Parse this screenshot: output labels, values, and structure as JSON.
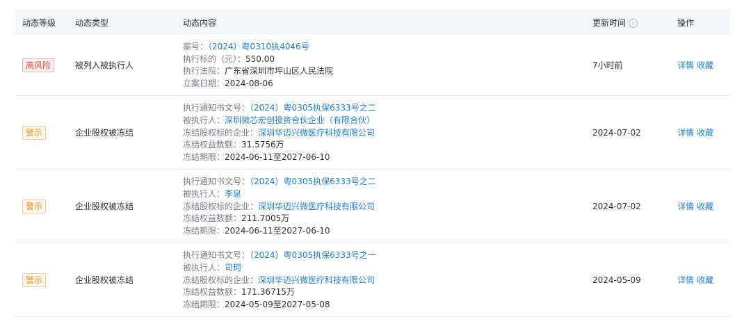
{
  "table": {
    "headers": {
      "level": "动态等级",
      "type": "动态类型",
      "content": "动态内容",
      "time": "更新时间",
      "ops": "操作"
    },
    "rows": [
      {
        "level": "高风险",
        "level_kind": "high",
        "type": "被列入被执行人",
        "fields": [
          {
            "label": "案号：",
            "value": "（2024）粤0310执4046号",
            "is_link": true
          },
          {
            "label": "执行标的（元）：",
            "value": "550.00",
            "is_link": false
          },
          {
            "label": "执行法院：",
            "value": "广东省深圳市坪山区人民法院",
            "is_link": false
          },
          {
            "label": "立案日期：",
            "value": "2024-08-06",
            "is_link": false
          }
        ],
        "time": "7小时前",
        "op_detail": "详情",
        "op_collect": "收藏"
      },
      {
        "level": "警示",
        "level_kind": "warn",
        "type": "企业股权被冻结",
        "fields": [
          {
            "label": "执行通知书文号：",
            "value": "（2024）粤0305执保6333号之二",
            "is_link": true
          },
          {
            "label": "被执行人：",
            "value": "深圳微芯宏创投资合伙企业（有限合伙）",
            "is_link": true
          },
          {
            "label": "冻结股权标的企业：",
            "value": "深圳华迈兴微医疗科技有限公司",
            "is_link": true
          },
          {
            "label": "冻结权益数额：",
            "value": "31.5756万",
            "is_link": false
          },
          {
            "label": "冻结期限：",
            "value": "2024-06-11至2027-06-10",
            "is_link": false
          }
        ],
        "time": "2024-07-02",
        "op_detail": "详情",
        "op_collect": "收藏"
      },
      {
        "level": "警示",
        "level_kind": "warn",
        "type": "企业股权被冻结",
        "fields": [
          {
            "label": "执行通知书文号：",
            "value": "（2024）粤0305执保6333号之二",
            "is_link": true
          },
          {
            "label": "被执行人：",
            "value": "李泉",
            "is_link": true
          },
          {
            "label": "冻结股权标的企业：",
            "value": "深圳华迈兴微医疗科技有限公司",
            "is_link": true
          },
          {
            "label": "冻结权益数额：",
            "value": "211.7005万",
            "is_link": false
          },
          {
            "label": "冻结期限：",
            "value": "2024-06-11至2027-06-10",
            "is_link": false
          }
        ],
        "time": "2024-07-02",
        "op_detail": "详情",
        "op_collect": "收藏"
      },
      {
        "level": "警示",
        "level_kind": "warn",
        "type": "企业股权被冻结",
        "fields": [
          {
            "label": "执行通知书文号：",
            "value": "（2024）粤0305执保6333号之一",
            "is_link": true
          },
          {
            "label": "被执行人：",
            "value": "司珂",
            "is_link": true
          },
          {
            "label": "冻结股权标的企业：",
            "value": "深圳华迈兴微医疗科技有限公司",
            "is_link": true
          },
          {
            "label": "冻结权益数额：",
            "value": "171.36715万",
            "is_link": false
          },
          {
            "label": "冻结期限：",
            "value": "2024-05-09至2027-05-08",
            "is_link": false
          }
        ],
        "time": "2024-05-09",
        "op_detail": "详情",
        "op_collect": "收藏"
      }
    ]
  },
  "colors": {
    "header_bg": "#f2f5fa",
    "link": "#1e7fd8",
    "high_risk": "#e8443b",
    "warning": "#f08c1a"
  },
  "icons": {
    "time_info": "info-circle-icon"
  }
}
